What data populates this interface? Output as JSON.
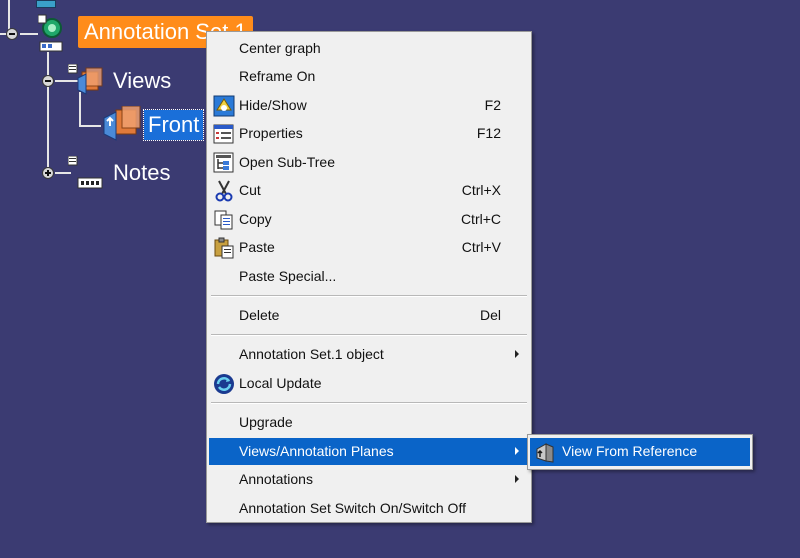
{
  "tree": {
    "nodes": {
      "annotation_set": "Annotation Set.1",
      "views": "Views",
      "front": "Front",
      "notes": "Notes"
    }
  },
  "context_menu": {
    "items": [
      {
        "label": "Center graph"
      },
      {
        "label": "Reframe On"
      },
      {
        "label": "Hide/Show",
        "shortcut": "F2",
        "icon": "hide-show-icon"
      },
      {
        "label": "Properties",
        "shortcut": "F12",
        "icon": "properties-icon"
      },
      {
        "label": "Open Sub-Tree",
        "icon": "sub-tree-icon"
      },
      {
        "label": "Cut",
        "shortcut": "Ctrl+X",
        "icon": "scissors-icon"
      },
      {
        "label": "Copy",
        "shortcut": "Ctrl+C",
        "icon": "copy-icon"
      },
      {
        "label": "Paste",
        "shortcut": "Ctrl+V",
        "icon": "paste-icon"
      },
      {
        "label": "Paste Special..."
      },
      {
        "label": "Delete",
        "shortcut": "Del"
      },
      {
        "label": "Annotation Set.1 object"
      },
      {
        "label": "Local Update",
        "icon": "local-update-icon"
      },
      {
        "label": "Upgrade"
      },
      {
        "label": "Views/Annotation Planes"
      },
      {
        "label": "Annotations"
      },
      {
        "label": "Annotation Set Switch On/Switch Off"
      }
    ]
  },
  "submenu": {
    "items": [
      {
        "label": "View From Reference",
        "icon": "view-from-reference-icon"
      }
    ]
  },
  "colors": {
    "background": "#3b3b72",
    "selection_orange": "#ff8c1a",
    "selection_blue": "#1a6fd9",
    "menu_highlight": "#0a64c8"
  }
}
